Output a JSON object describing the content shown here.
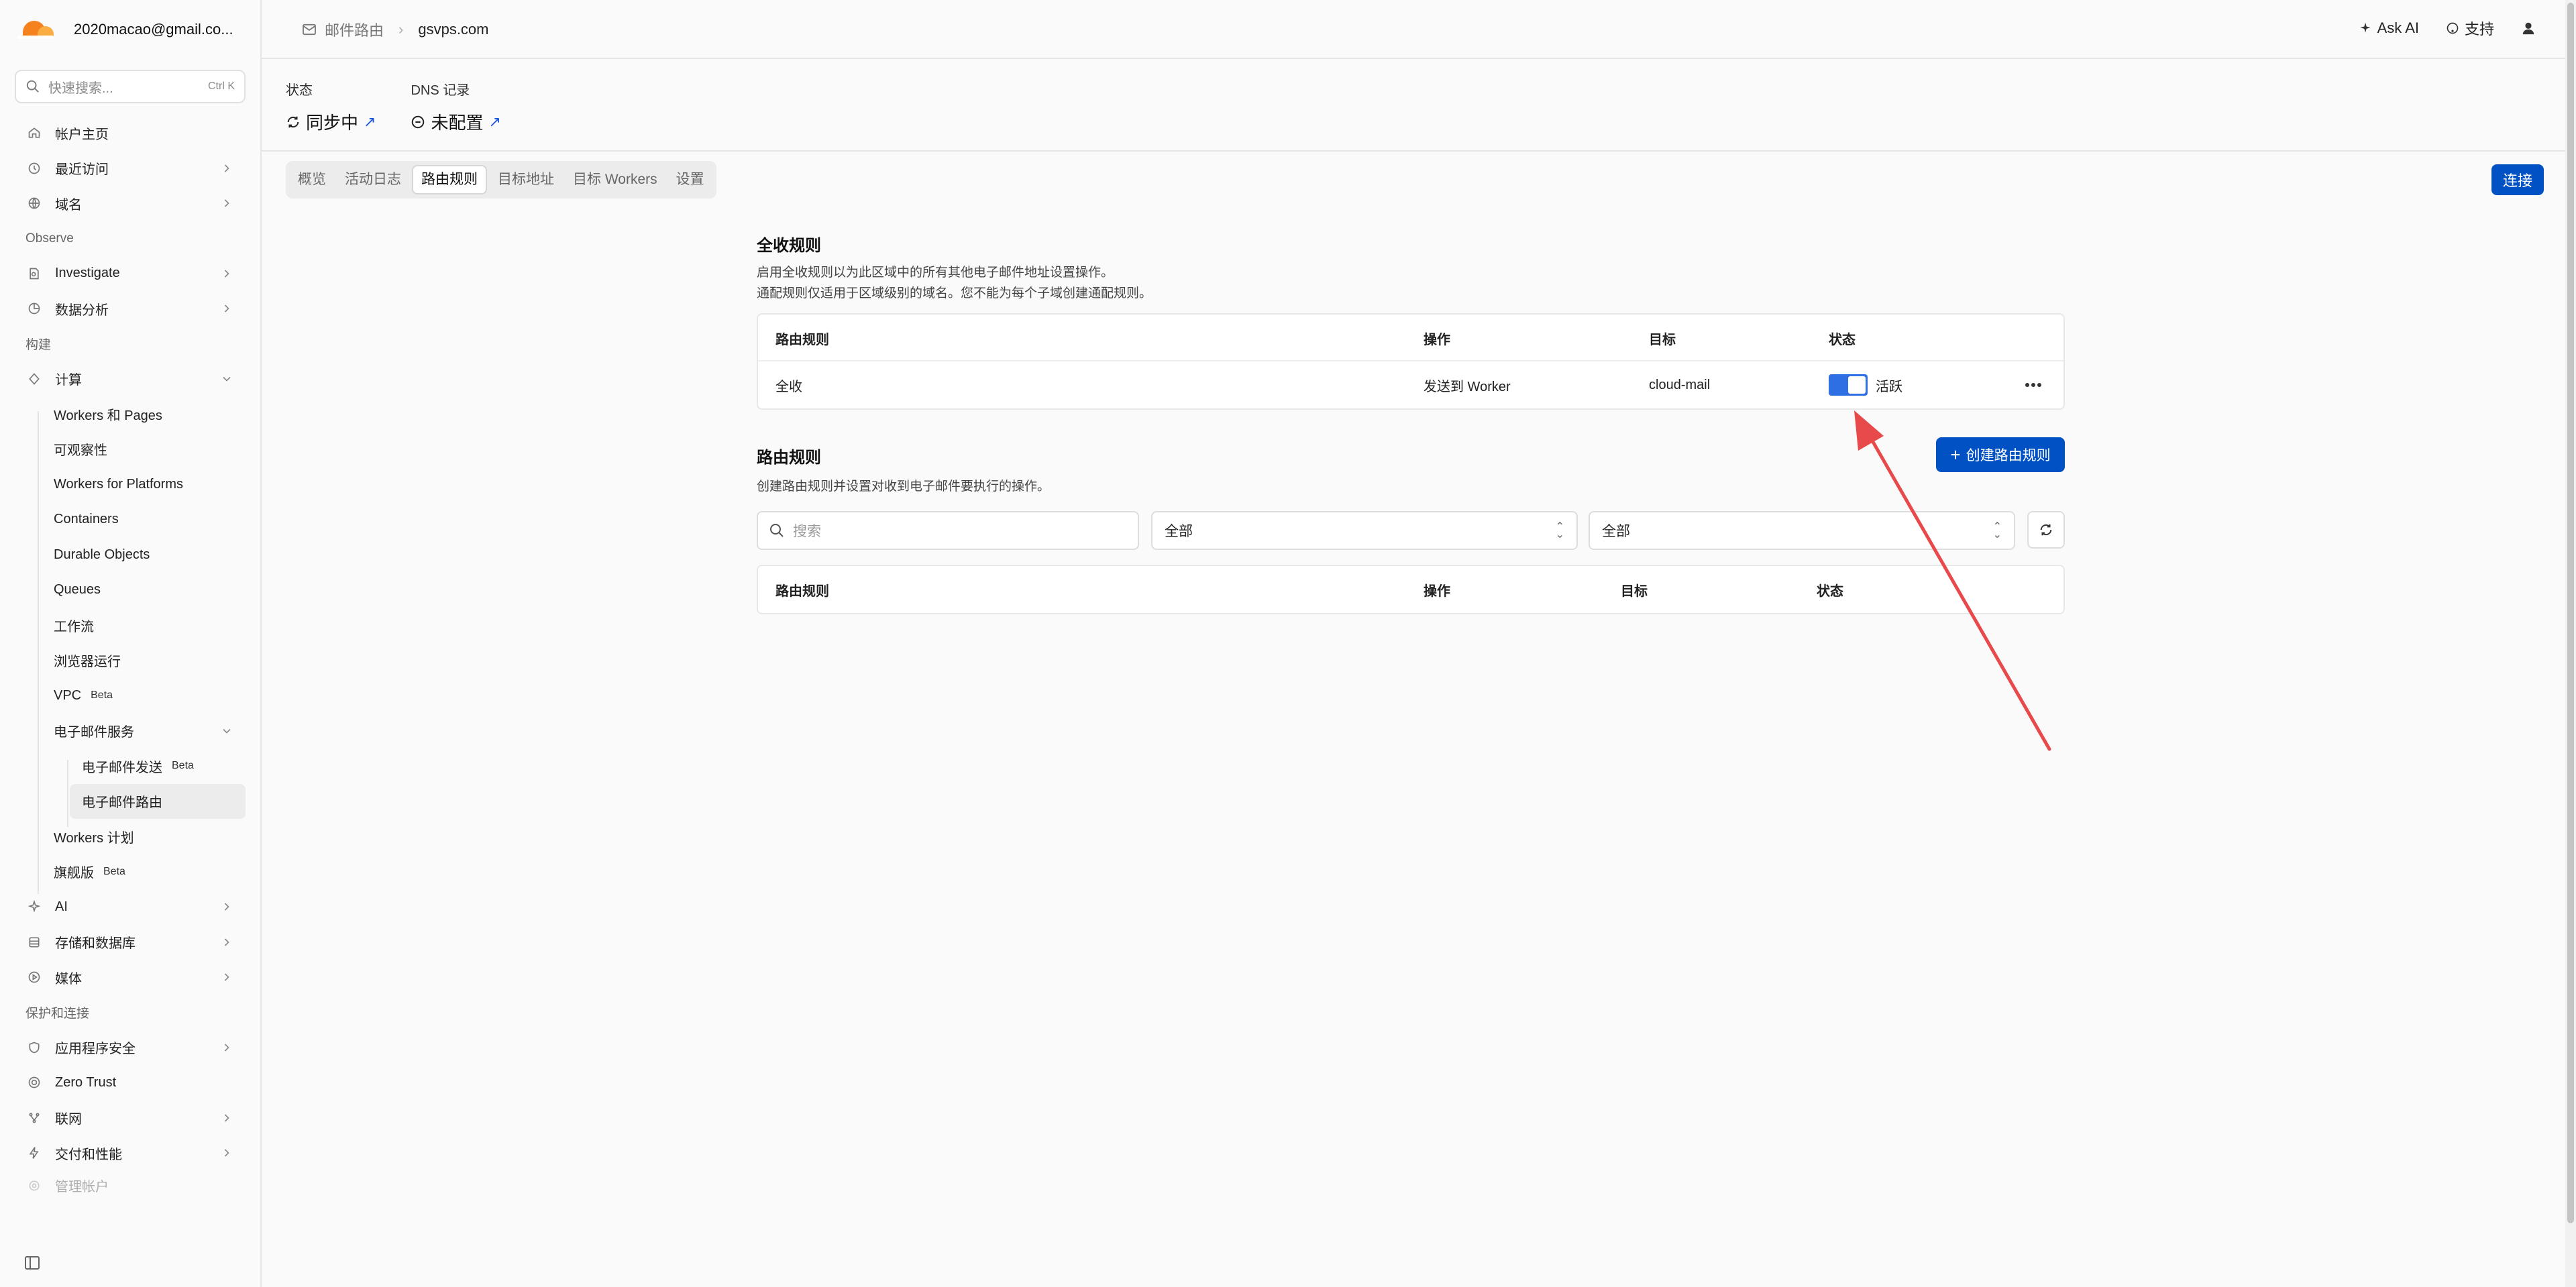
{
  "account": {
    "name": "2020macao@gmail.co..."
  },
  "search": {
    "placeholder": "快速搜索...",
    "shortcut": "Ctrl K"
  },
  "sidebar": {
    "items_top": [
      {
        "label": "帐户主页",
        "icon": "home-icon"
      },
      {
        "label": "最近访问",
        "icon": "clock-icon"
      },
      {
        "label": "域名",
        "icon": "globe-icon"
      }
    ],
    "section_observe": "Observe",
    "items_observe": [
      {
        "label": "Investigate",
        "icon": "document-search-icon"
      },
      {
        "label": "数据分析",
        "icon": "chart-icon"
      }
    ],
    "section_build": "构建",
    "compute_label": "计算",
    "compute_children": [
      {
        "label": "Workers 和 Pages"
      },
      {
        "label": "可观察性"
      },
      {
        "label": "Workers for Platforms"
      },
      {
        "label": "Containers"
      },
      {
        "label": "Durable Objects"
      },
      {
        "label": "Queues"
      },
      {
        "label": "工作流"
      },
      {
        "label": "浏览器运行"
      },
      {
        "label": "VPC",
        "badge": "Beta"
      }
    ],
    "email_label": "电子邮件服务",
    "email_children": [
      {
        "label": "电子邮件发送",
        "badge": "Beta"
      },
      {
        "label": "电子邮件路由"
      }
    ],
    "after_email": [
      {
        "label": "Workers 计划"
      },
      {
        "label": "旗舰版",
        "badge": "Beta"
      }
    ],
    "items_more": [
      {
        "label": "AI",
        "icon": "ai-icon"
      },
      {
        "label": "存储和数据库",
        "icon": "database-icon"
      },
      {
        "label": "媒体",
        "icon": "media-icon"
      }
    ],
    "section_protect": "保护和连接",
    "items_protect": [
      {
        "label": "应用程序安全",
        "icon": "shield-icon"
      },
      {
        "label": "Zero Trust",
        "icon": "zero-trust-icon"
      },
      {
        "label": "联网",
        "icon": "network-icon"
      },
      {
        "label": "交付和性能",
        "icon": "bolt-icon"
      }
    ],
    "partial_item": "管理帐户"
  },
  "topbar": {
    "crumb_parent": "邮件路由",
    "crumb_current": "gsvps.com",
    "ask_ai": "Ask AI",
    "support": "支持"
  },
  "status": {
    "state_label": "状态",
    "state_value": "同步中",
    "dns_label": "DNS 记录",
    "dns_value": "未配置"
  },
  "tabs": [
    "概览",
    "活动日志",
    "路由规则",
    "目标地址",
    "目标 Workers",
    "设置"
  ],
  "active_tab_index": 2,
  "connect_button": "连接",
  "catch_all": {
    "title": "全收规则",
    "desc_line1": "启用全收规则以为此区域中的所有其他电子邮件地址设置操作。",
    "desc_line2": "通配规则仅适用于区域级别的域名。您不能为每个子域创建通配规则。",
    "columns": [
      "路由规则",
      "操作",
      "目标",
      "状态"
    ],
    "row": {
      "rule": "全收",
      "action": "发送到 Worker",
      "target": "cloud-mail",
      "status": "活跃",
      "enabled": true
    }
  },
  "routing": {
    "title": "路由规则",
    "desc": "创建路由规则并设置对收到电子邮件要执行的操作。",
    "create_button": "创建路由规则",
    "search_placeholder": "搜索",
    "filter1": "全部",
    "filter2": "全部",
    "columns": [
      "路由规则",
      "操作",
      "目标",
      "状态"
    ]
  },
  "colors": {
    "accent": "#0051c3",
    "toggle": "#2f6fe4",
    "annotation_arrow": "#e8494a"
  }
}
